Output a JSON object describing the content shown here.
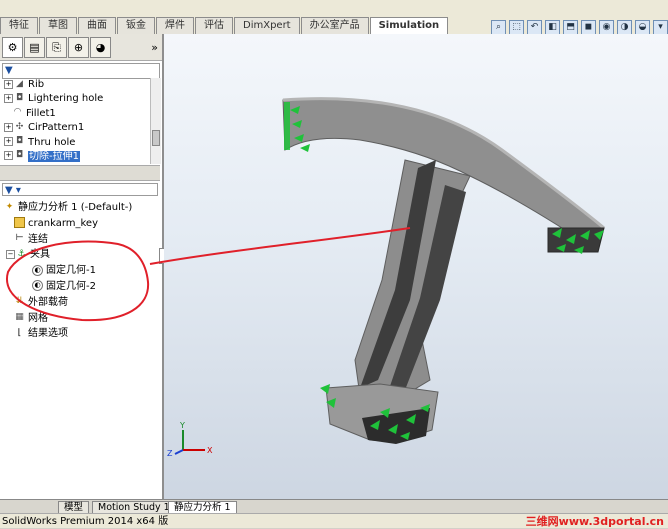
{
  "command_tabs": [
    "特征",
    "草图",
    "曲面",
    "钣金",
    "焊件",
    "评估",
    "DimXpert",
    "办公室产品",
    "Simulation"
  ],
  "active_command_tab": 8,
  "view_toolbar_icons": [
    "zoom-to-fit-icon",
    "zoom-area-icon",
    "previous-view-icon",
    "section-view-icon",
    "view-orientation-icon",
    "display-style-icon",
    "hide-show-icon",
    "edit-appearance-icon",
    "apply-scene-icon",
    "view-settings-icon"
  ],
  "left_panel_tabs": [
    "feature-manager-icon",
    "property-manager-icon",
    "configuration-manager-icon",
    "dimxpert-manager-icon",
    "display-manager-icon"
  ],
  "left_panel_expand": "»",
  "filter_symbol": "▼",
  "feature_tree": [
    {
      "label": "Rib",
      "icon": "rib-icon",
      "expander": "+"
    },
    {
      "label": "Lightering hole",
      "icon": "extrude-cut-icon",
      "expander": "+"
    },
    {
      "label": "Fillet1",
      "icon": "fillet-icon",
      "expander": ""
    },
    {
      "label": "CirPattern1",
      "icon": "circular-pattern-icon",
      "expander": "+"
    },
    {
      "label": "Thru hole",
      "icon": "extrude-cut-icon",
      "expander": "+"
    },
    {
      "label": "切除-拉伸1",
      "icon": "extrude-cut-icon",
      "expander": "+",
      "selected": true
    }
  ],
  "filter2_symbol": "▼ ▾",
  "study_tree": {
    "study": "静应力分析 1 (-Default-)",
    "part": "crankarm_key",
    "connections": "连结",
    "fixtures": "夹具",
    "fixture_items": [
      "固定几何-1",
      "固定几何-2"
    ],
    "external_loads": "外部载荷",
    "mesh": "网格",
    "results_options": "结果选项"
  },
  "bottom_tabs": [
    "模型",
    "Motion Study 1",
    "静应力分析 1"
  ],
  "active_bottom_tab": 2,
  "status_text": "SolidWorks Premium 2014 x64 版",
  "watermark": "三维网www.3dportal.cn",
  "colors": {
    "selection_blue": "#3470c8",
    "annotation_red": "#e0202a",
    "fixture_green": "#1fc23a",
    "model_gray": "#8a8a8a"
  }
}
